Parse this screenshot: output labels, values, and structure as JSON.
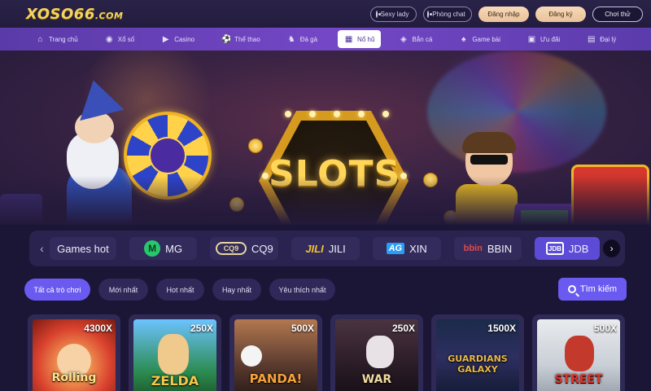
{
  "header": {
    "logo_main": "XOSO66",
    "logo_domain": ".COM",
    "actions": {
      "sexy_lady": "Sexy lady",
      "play_chat": "Phòng chat",
      "login": "Đăng nhập",
      "register": "Đăng ký",
      "try_play": "Chơi thử"
    }
  },
  "nav": {
    "items": [
      {
        "label": "Trang chủ",
        "icon": "home-icon"
      },
      {
        "label": "Xổ số",
        "icon": "lottery-icon"
      },
      {
        "label": "Casino",
        "icon": "casino-icon"
      },
      {
        "label": "Thể thao",
        "icon": "sports-ball-icon"
      },
      {
        "label": "Đá gà",
        "icon": "rooster-icon"
      },
      {
        "label": "Nổ hũ",
        "icon": "slot-machine-icon",
        "active": true
      },
      {
        "label": "Bắn cá",
        "icon": "fish-icon"
      },
      {
        "label": "Game bài",
        "icon": "cards-icon"
      },
      {
        "label": "Ưu đãi",
        "icon": "gift-icon"
      },
      {
        "label": "Đại lý",
        "icon": "agent-icon"
      }
    ]
  },
  "banner": {
    "title": "SLOTS"
  },
  "providers": {
    "items": [
      {
        "label": "Games hot",
        "logo": ""
      },
      {
        "label": "MG",
        "logo": "M"
      },
      {
        "label": "CQ9",
        "logo": "CQ9"
      },
      {
        "label": "JILI",
        "logo": "JILI"
      },
      {
        "label": "XIN",
        "logo": "AG"
      },
      {
        "label": "BBIN",
        "logo": "bbin"
      },
      {
        "label": "JDB",
        "logo": "JDB",
        "active": true
      }
    ]
  },
  "filters": {
    "items": [
      {
        "label": "Tất cả trò chơi",
        "active": true
      },
      {
        "label": "Mới nhất"
      },
      {
        "label": "Hot nhất"
      },
      {
        "label": "Hay nhất"
      },
      {
        "label": "Yêu thích nhất"
      }
    ],
    "search_label": "Tìm kiếm"
  },
  "games": [
    {
      "multiplier": "4300X",
      "title": "Rolling"
    },
    {
      "multiplier": "250X",
      "title": "ZELDA"
    },
    {
      "multiplier": "500X",
      "title": "PANDA!"
    },
    {
      "multiplier": "250X",
      "title": "WAR"
    },
    {
      "multiplier": "1500X",
      "title": "GUARDIANS GALAXY"
    },
    {
      "multiplier": "500X",
      "title": "STREET"
    }
  ],
  "colors": {
    "accent": "#6a5af0",
    "nav_bg": "#6a43bd",
    "page_bg": "#1b1536",
    "gold": "#ffd55a"
  }
}
